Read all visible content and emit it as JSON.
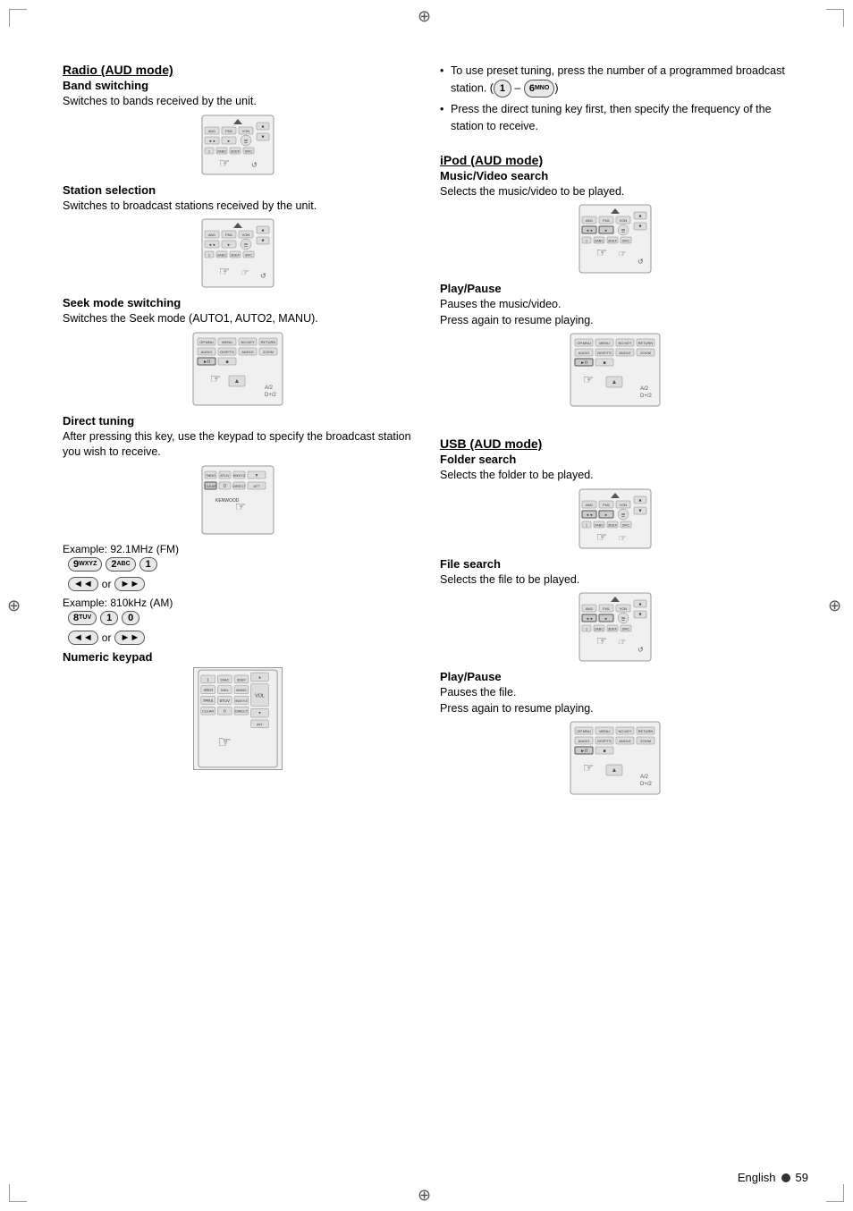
{
  "page": {
    "title": "Radio and iPod/USB AUD mode instructions",
    "footer": {
      "language": "English",
      "page_number": "59"
    }
  },
  "left_column": {
    "section1": {
      "title": "Radio (AUD mode)",
      "subsections": [
        {
          "id": "band-switching",
          "subtitle": "Band switching",
          "text": "Switches to bands received by the unit."
        },
        {
          "id": "station-selection",
          "subtitle": "Station selection",
          "text": "Switches to broadcast stations received by the unit."
        },
        {
          "id": "seek-mode",
          "subtitle": "Seek mode switching",
          "text": "Switches the Seek mode (AUTO1, AUTO2, MANU)."
        },
        {
          "id": "direct-tuning",
          "subtitle": "Direct tuning",
          "text": "After pressing this key, use the keypad to specify the broadcast station you wish to receive."
        }
      ]
    },
    "direct_tuning_examples": [
      {
        "label": "Example: 92.1MHz (FM)",
        "buttons": [
          "9wxyz",
          "2abc",
          "1"
        ],
        "or_buttons": [
          "◄◄",
          "or",
          "►►"
        ]
      },
      {
        "label": "Example: 810kHz (AM)",
        "buttons": [
          "8tuv",
          "1",
          "0"
        ],
        "or_buttons": [
          "◄◄",
          "or",
          "►►"
        ]
      }
    ],
    "numeric_keypad": {
      "subtitle": "Numeric keypad"
    }
  },
  "right_column": {
    "bullet_points": [
      "To use preset tuning, press the number of a programmed broadcast station. (1 – 6MNO)",
      "Press the direct tuning key first, then specify the frequency of the station to receive."
    ],
    "section2": {
      "title": "iPod (AUD mode)",
      "subsections": [
        {
          "id": "music-video-search",
          "subtitle": "Music/Video search",
          "text": "Selects the music/video to be played."
        },
        {
          "id": "play-pause-ipod",
          "subtitle": "Play/Pause",
          "text": "Pauses the music/video.\nPress again to resume playing."
        }
      ]
    },
    "section3": {
      "title": "USB (AUD mode)",
      "subsections": [
        {
          "id": "folder-search",
          "subtitle": "Folder search",
          "text": "Selects the folder to be played."
        },
        {
          "id": "file-search",
          "subtitle": "File search",
          "text": "Selects the file to be played."
        },
        {
          "id": "play-pause-usb",
          "subtitle": "Play/Pause",
          "text": "Pauses the file.\nPress again to resume playing."
        }
      ]
    }
  }
}
